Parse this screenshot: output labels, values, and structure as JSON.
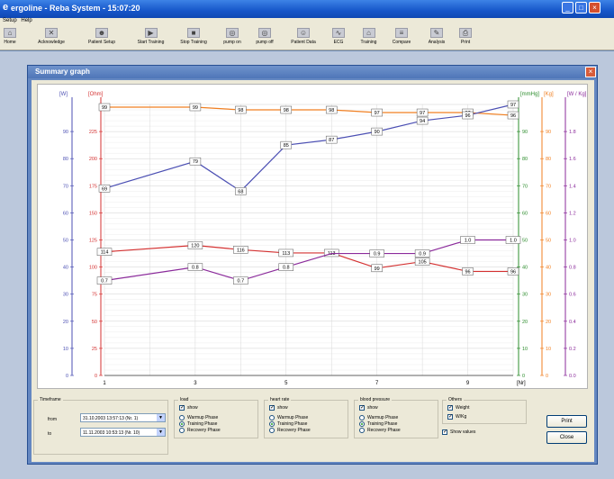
{
  "window": {
    "title": "ergoline - Reba System - 15:07:20"
  },
  "menu": [
    "Setup",
    "Help"
  ],
  "toolbar": [
    "Home",
    "Acknowledge",
    "Patient Setup",
    "Start Training",
    "Stop Training",
    "pump on",
    "pump off",
    "Patient Data",
    "ECG",
    "Training",
    "Compare",
    "Analysis",
    "Print"
  ],
  "dialog": {
    "title": "Summary graph"
  },
  "axes": {
    "w": {
      "label": "[W]",
      "ticks": [
        "0",
        "10",
        "20",
        "30",
        "40",
        "50",
        "60",
        "70",
        "80",
        "90"
      ],
      "color": "#4b4fb3"
    },
    "ohm": {
      "label": "[Ohm]",
      "ticks": [
        "0",
        "25",
        "50",
        "75",
        "100",
        "125",
        "150",
        "175",
        "200",
        "225"
      ],
      "color": "#d43131"
    },
    "mmhg": {
      "label": "[mmHg]",
      "ticks": [
        "0",
        "10",
        "20",
        "30",
        "40",
        "50",
        "60",
        "70",
        "80",
        "90"
      ],
      "color": "#2c8c2c"
    },
    "kg": {
      "label": "[Kg]",
      "ticks": [
        "0",
        "10",
        "20",
        "30",
        "40",
        "50",
        "60",
        "70",
        "80",
        "90"
      ],
      "color": "#f07f21"
    },
    "wkg": {
      "label": "[W / Kg]",
      "ticks": [
        "0.0",
        "0.2",
        "0.4",
        "0.6",
        "0.8",
        "1.0",
        "1.2",
        "1.4",
        "1.6",
        "1.8"
      ],
      "color": "#8b2b9b"
    },
    "x": {
      "label": "[Nr]",
      "ticks": [
        "1",
        "3",
        "5",
        "7",
        "9"
      ]
    }
  },
  "chart_data": {
    "type": "line",
    "x": [
      1,
      2,
      3,
      4,
      5,
      6,
      7,
      8,
      9,
      10
    ],
    "series": [
      {
        "values": [
          99,
          null,
          99,
          98,
          98,
          98,
          97,
          97,
          97,
          96
        ],
        "color": "#f07f21",
        "labels": [
          "99",
          "",
          "99",
          "98",
          "98",
          "98",
          "97",
          "97",
          "97",
          "96"
        ]
      },
      {
        "values": [
          69,
          null,
          79,
          68,
          85,
          87,
          90,
          94,
          96,
          100
        ],
        "color": "#4b4fb3",
        "labels": [
          "69",
          "",
          "79",
          "68",
          "85",
          "87",
          "90",
          "94",
          "96",
          "97"
        ]
      },
      {
        "values": [
          114,
          null,
          120,
          116,
          113,
          113,
          99,
          105,
          96,
          96
        ],
        "scale": "ohm",
        "color": "#d43131",
        "labels": [
          "114",
          "",
          "120",
          "116",
          "113",
          "113",
          "99",
          "105",
          "96",
          "96"
        ]
      },
      {
        "values": [
          0.7,
          null,
          0.8,
          0.7,
          0.8,
          0.9,
          0.9,
          0.9,
          1.0,
          1.0
        ],
        "scale": "wkg",
        "color": "#8b2b9b",
        "labels": [
          "0.7",
          "",
          "0.8",
          "0.7",
          "0.8",
          "",
          "0.9",
          "0.9",
          "1.0",
          "1.0"
        ]
      }
    ]
  },
  "timeframe": {
    "legend": "Timeframe",
    "from_label": "from",
    "to_label": "to",
    "from_value": "31.10.2003 13:57:13 (Nr. 1)",
    "to_value": "11.11.2003 10:53:13 (Nr. 10)"
  },
  "groups": [
    {
      "legend": "load",
      "show": "show",
      "phases": [
        "Warmup Phase",
        "Training Phase",
        "Recovery Phase"
      ]
    },
    {
      "legend": "heart rate",
      "show": "show",
      "phases": [
        "Warmup Phase",
        "Training Phase",
        "Recovery Phase"
      ]
    },
    {
      "legend": "blood pressure",
      "show": "show",
      "phases": [
        "Warmup Phase",
        "Training Phase",
        "Recovery Phase"
      ]
    }
  ],
  "others": {
    "legend": "Others",
    "weight": "Weight",
    "wkg": "W/Kg",
    "show_values": "Show values"
  },
  "buttons": {
    "print": "Print",
    "close": "Close"
  }
}
